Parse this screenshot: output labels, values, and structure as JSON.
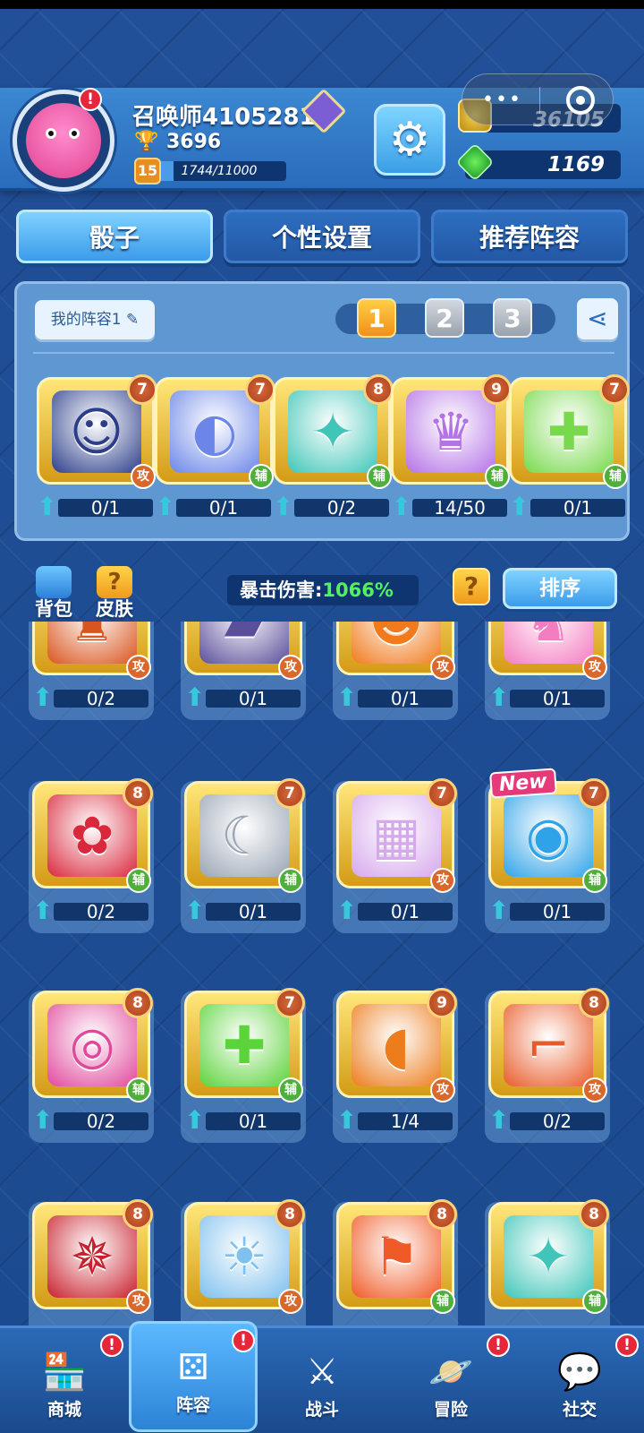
{
  "player": {
    "name": "召唤师4105281",
    "trophies": "3696",
    "level": "15",
    "xp": "1744/11000",
    "xp_fraction": 0.159
  },
  "resources": {
    "gold": "36105",
    "gems": "1169"
  },
  "tabs": [
    {
      "label": "骰子",
      "active": true
    },
    {
      "label": "个性设置",
      "active": false
    },
    {
      "label": "推荐阵容",
      "active": false
    }
  ],
  "deck": {
    "name": "我的阵容1",
    "slots": [
      "1",
      "2",
      "3"
    ],
    "active_slot": 0,
    "dice": [
      {
        "level": "7",
        "role": "攻",
        "progress": "0/1",
        "icon": "lion-icon",
        "color": "#2c3e8a"
      },
      {
        "level": "7",
        "role": "辅",
        "progress": "0/1",
        "icon": "mask-icon",
        "color": "#6b86e8"
      },
      {
        "level": "8",
        "role": "辅",
        "progress": "0/2",
        "icon": "vortex-icon",
        "color": "#3fc6b8"
      },
      {
        "level": "9",
        "role": "辅",
        "progress": "14/50",
        "icon": "magic-hat-icon",
        "color": "#b472e6"
      },
      {
        "level": "7",
        "role": "辅",
        "progress": "0/1",
        "icon": "heal-cross-icon",
        "color": "#78d94c"
      }
    ]
  },
  "toolbar": {
    "bag_label": "背包",
    "skin_label": "皮肤",
    "crit_label": "暴击伤害:",
    "crit_value": "1066%",
    "help": "?",
    "sort_label": "排序"
  },
  "collection": [
    {
      "level": "",
      "role": "攻",
      "progress": "0/2",
      "icon": "trophy-icon",
      "color": "#d9551f"
    },
    {
      "level": "",
      "role": "攻",
      "progress": "0/1",
      "icon": "cannon-icon",
      "color": "#5a4f9a"
    },
    {
      "level": "",
      "role": "攻",
      "progress": "0/1",
      "icon": "pumpkin-icon",
      "color": "#f07a1c"
    },
    {
      "level": "",
      "role": "攻",
      "progress": "0/1",
      "icon": "cat-icon",
      "color": "#f47cc0"
    },
    {
      "level": "8",
      "role": "辅",
      "progress": "0/2",
      "icon": "paw-icon",
      "color": "#d9283c"
    },
    {
      "level": "7",
      "role": "辅",
      "progress": "0/1",
      "icon": "moon-icon",
      "color": "#9aa5b4"
    },
    {
      "level": "7",
      "role": "攻",
      "progress": "0/1",
      "icon": "blocks-icon",
      "color": "#d6a8ec"
    },
    {
      "level": "7",
      "role": "辅",
      "progress": "0/1",
      "icon": "signal-icon",
      "color": "#2fa3e8",
      "new": "New"
    },
    {
      "level": "8",
      "role": "辅",
      "progress": "0/2",
      "icon": "eye-icon",
      "color": "#e0489c"
    },
    {
      "level": "7",
      "role": "辅",
      "progress": "0/1",
      "icon": "cross-icon",
      "color": "#5bd33a"
    },
    {
      "level": "9",
      "role": "攻",
      "progress": "1/4",
      "icon": "bread-icon",
      "color": "#ec7c1c"
    },
    {
      "level": "8",
      "role": "攻",
      "progress": "0/2",
      "icon": "gun-icon",
      "color": "#e85a28"
    },
    {
      "level": "8",
      "role": "攻",
      "progress": "",
      "icon": "shuriken-icon",
      "color": "#c8202c"
    },
    {
      "level": "8",
      "role": "攻",
      "progress": "",
      "icon": "sun-icon",
      "color": "#7ec0ee"
    },
    {
      "level": "8",
      "role": "辅",
      "progress": "",
      "icon": "flag-icon",
      "color": "#f05a26"
    },
    {
      "level": "8",
      "role": "辅",
      "progress": "",
      "icon": "vortex-icon",
      "color": "#3fc6b8"
    }
  ],
  "nav": [
    {
      "label": "商城",
      "icon": "shop-icon",
      "badge": "!"
    },
    {
      "label": "阵容",
      "icon": "dice-icon",
      "badge": "!",
      "active": true
    },
    {
      "label": "战斗",
      "icon": "swords-icon",
      "badge": ""
    },
    {
      "label": "冒险",
      "icon": "planet-icon",
      "badge": "!"
    },
    {
      "label": "社交",
      "icon": "chat-icon",
      "badge": "!"
    }
  ],
  "glyphs": {
    "gear": "⚙",
    "trophy": "🏆",
    "share": "⋖",
    "pencil": "✎",
    "up_arrow": "⬆",
    "badge": "!"
  }
}
